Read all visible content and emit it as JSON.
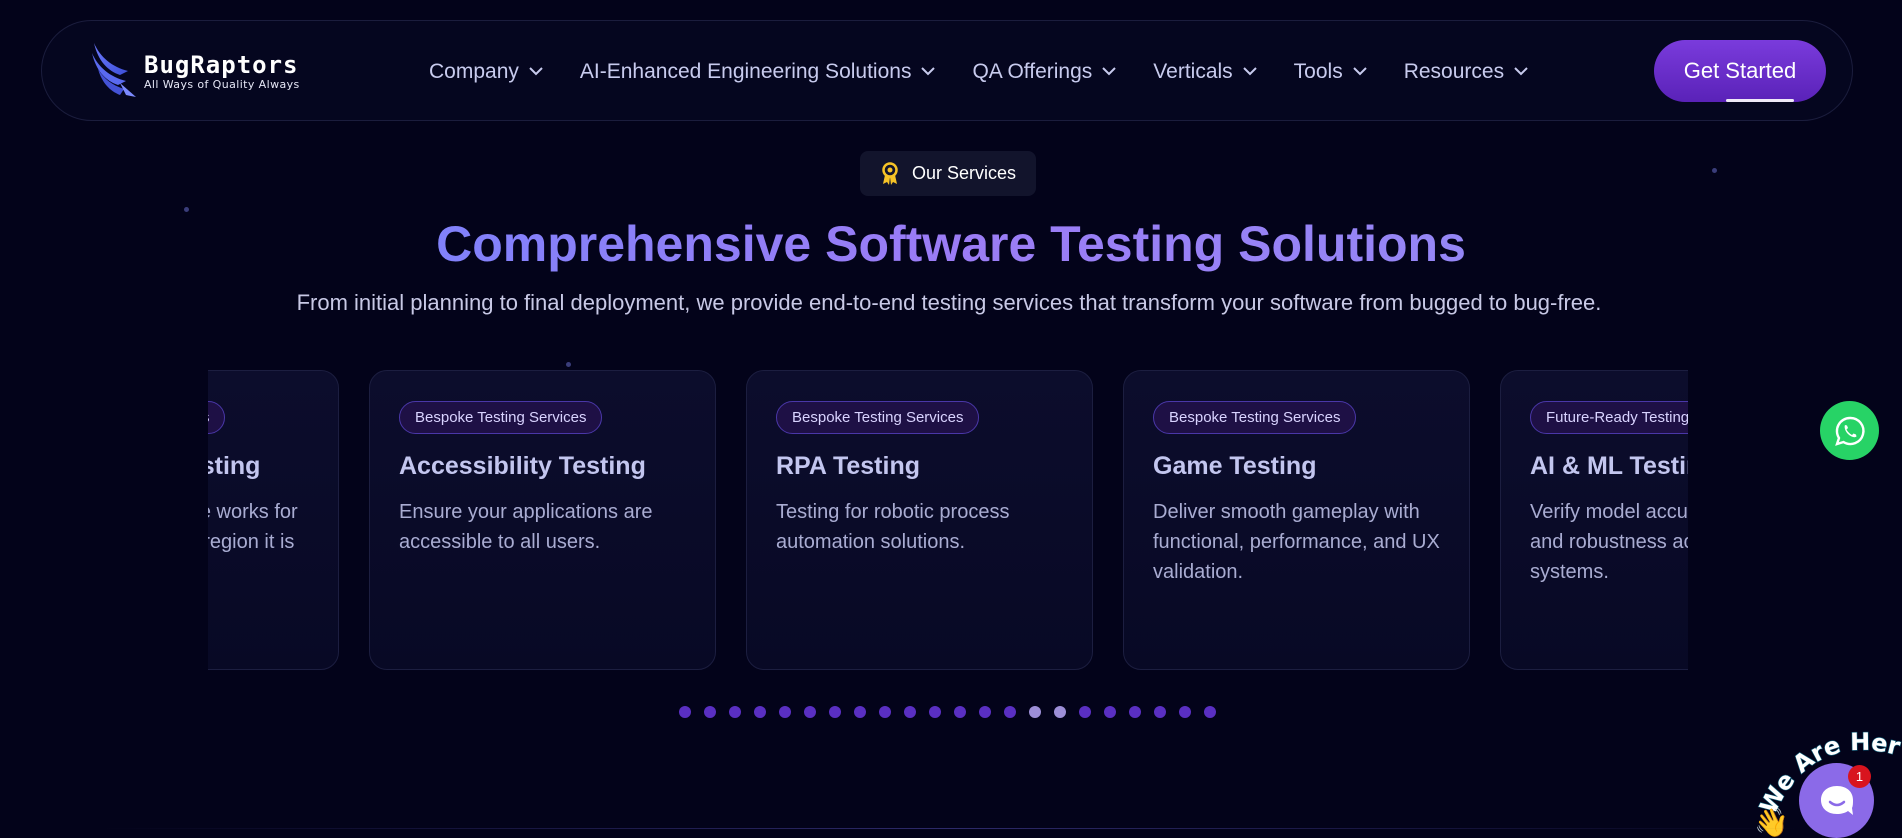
{
  "brand": {
    "name": "BugRaptors",
    "tagline": "All Ways of Quality Always"
  },
  "nav": {
    "items": [
      {
        "label": "Company"
      },
      {
        "label": "AI-Enhanced Engineering Solutions"
      },
      {
        "label": "QA Offerings"
      },
      {
        "label": "Verticals"
      },
      {
        "label": "Tools"
      },
      {
        "label": "Resources"
      }
    ],
    "cta_label": "Get Started"
  },
  "section": {
    "badge_label": "Our Services",
    "title": "Comprehensive Software Testing Solutions",
    "subtitle": "From initial planning to final deployment, we provide end-to-end testing services that transform your software from bugged to bug-free."
  },
  "cards": [
    {
      "tag": "Bespoke Testing Services",
      "title": "Localization Testing",
      "description": "Ensure your software works for every language and region it is serving."
    },
    {
      "tag": "Bespoke Testing Services",
      "title": "Accessibility Testing",
      "description": "Ensure your applications are accessible to all users."
    },
    {
      "tag": "Bespoke Testing Services",
      "title": "RPA Testing",
      "description": "Testing for robotic process automation solutions."
    },
    {
      "tag": "Bespoke Testing Services",
      "title": "Game Testing",
      "description": "Deliver smooth gameplay with functional, performance, and UX validation."
    },
    {
      "tag": "Future-Ready Testing",
      "title": "AI & ML Testing",
      "description": "Verify model accuracy, fairness, and robustness across data and systems."
    }
  ],
  "carousel": {
    "dot_count": 22,
    "active_dots": [
      14,
      15
    ]
  },
  "chat": {
    "unread_count": "1",
    "we_are_here": "We Are Here!"
  },
  "colors": {
    "background": "#03031a",
    "accent": "#6b2fd0",
    "whatsapp": "#27d366",
    "chat": "#8b6ae8"
  }
}
